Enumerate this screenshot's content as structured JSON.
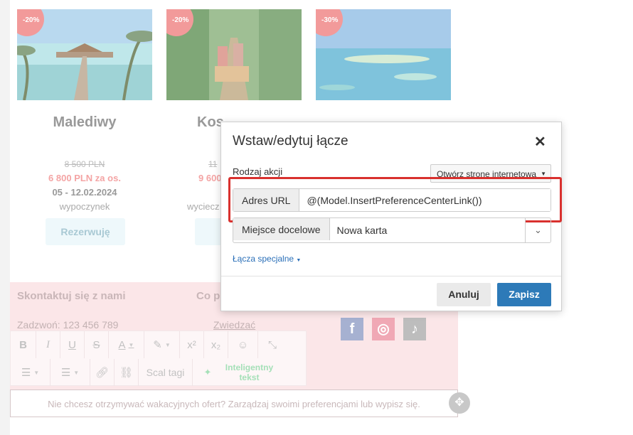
{
  "offers": [
    {
      "badge": "-20%",
      "title": "Malediwy",
      "old_price": "8 500 PLN",
      "price": "6 800 PLN za os.",
      "dates": "05 - 12.02.2024",
      "kind": "wypoczynek",
      "book": "Rezerwuję"
    },
    {
      "badge": "-20%",
      "title": "Kos",
      "old_price": "11",
      "price": "9 600",
      "dates": "",
      "kind": "wyciecz",
      "book": "Re"
    },
    {
      "badge": "-30%",
      "title": "",
      "old_price": "",
      "price": "",
      "dates": "",
      "kind": "",
      "book": ""
    }
  ],
  "footer_section": {
    "contact_heading": "Skontaktuj się z nami",
    "second_heading": "Co p",
    "phone": "Zadzwoń: 123 456 789",
    "visit": "Zwiedzać"
  },
  "toolbar": {
    "merge_tags": "Scal tagi",
    "smart_text": "Inteligentny tekst"
  },
  "footer_text": "Nie chcesz otrzymywać wakacyjnych ofert? Zarządzaj swoimi preferencjami lub wypisz się.",
  "dialog": {
    "title": "Wstaw/edytuj łącze",
    "action_type_label": "Rodzaj akcji",
    "action_type_value": "Otwórz stronę internetową",
    "url_label": "Adres URL",
    "url_value": "@(Model.InsertPreferenceCenterLink())",
    "target_label": "Miejsce docelowe",
    "target_value": "Nowa karta",
    "special_links": "Łącza specjalne",
    "cancel": "Anuluj",
    "save": "Zapisz"
  },
  "colors": {
    "save_button": "#2d7ab8",
    "highlight": "#d9312e"
  }
}
